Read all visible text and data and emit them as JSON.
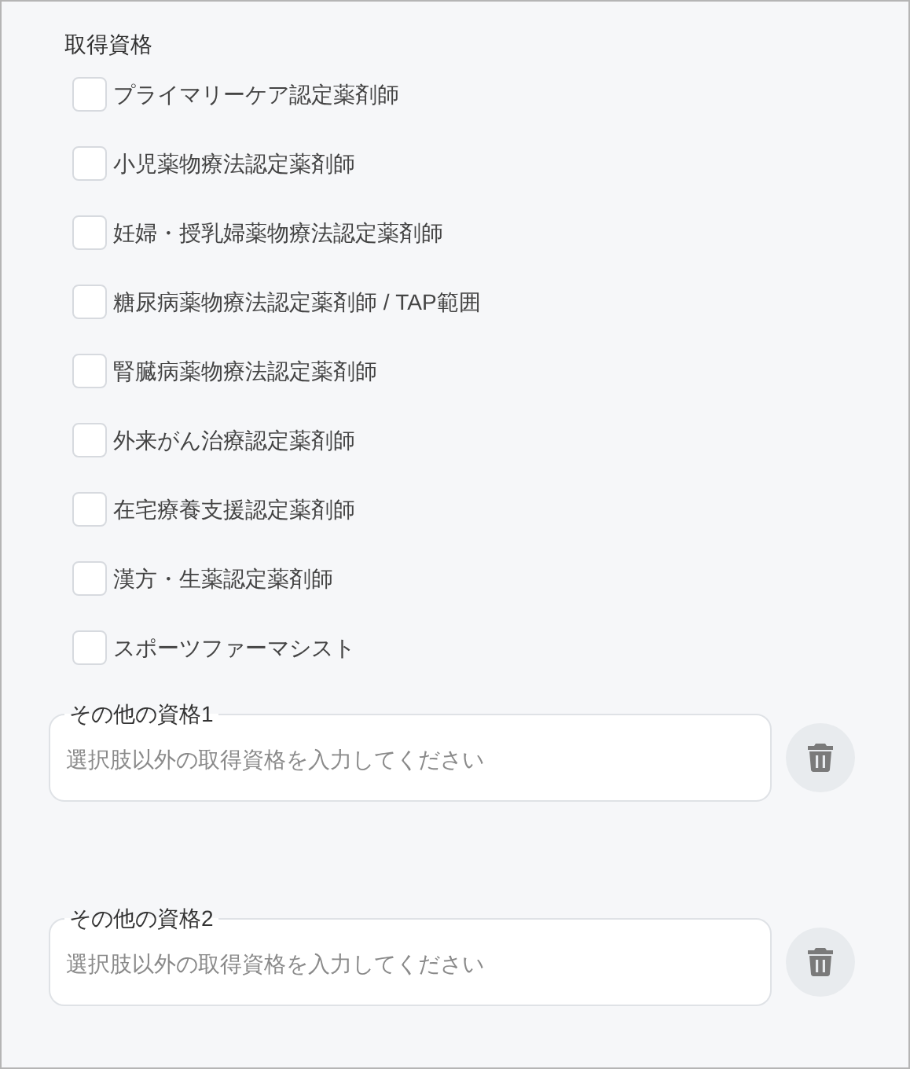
{
  "section_title": "取得資格",
  "qualifications": [
    {
      "label": "プライマリーケア認定薬剤師",
      "checked": false
    },
    {
      "label": "小児薬物療法認定薬剤師",
      "checked": false
    },
    {
      "label": "妊婦・授乳婦薬物療法認定薬剤師",
      "checked": false
    },
    {
      "label": "糖尿病薬物療法認定薬剤師 / TAP範囲",
      "checked": false
    },
    {
      "label": "腎臓病薬物療法認定薬剤師",
      "checked": false
    },
    {
      "label": "外来がん治療認定薬剤師",
      "checked": false
    },
    {
      "label": "在宅療養支援認定薬剤師",
      "checked": false
    },
    {
      "label": "漢方・生薬認定薬剤師",
      "checked": false
    },
    {
      "label": "スポーツファーマシスト",
      "checked": false
    }
  ],
  "other_fields": [
    {
      "label": "その他の資格1",
      "placeholder": "選択肢以外の取得資格を入力してください"
    },
    {
      "label": "その他の資格2",
      "placeholder": "選択肢以外の取得資格を入力してください"
    }
  ]
}
